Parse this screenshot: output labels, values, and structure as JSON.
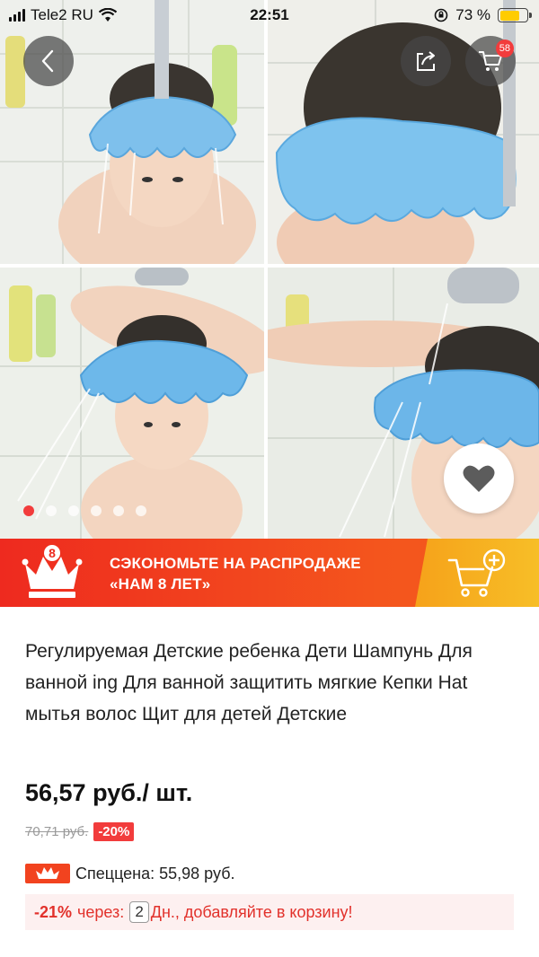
{
  "status_bar": {
    "carrier": "Tele2 RU",
    "time": "22:51",
    "battery_text": "73 %",
    "battery_level": 0.73,
    "battery_color": "#ffcc00"
  },
  "header": {
    "back_icon": "chevron-left-icon",
    "share_icon": "share-icon",
    "cart_icon": "cart-icon",
    "cart_count": "58"
  },
  "gallery": {
    "photo_count": 6,
    "active_index": 0,
    "favorite_icon": "heart-icon"
  },
  "promo": {
    "line1": "СЭКОНОМЬТЕ НА РАСПРОДАЖЕ",
    "line2": "«НАМ 8 ЛЕТ»",
    "logo_icon": "crown-8-icon",
    "cart_icon": "cart-plus-icon",
    "colors": {
      "banner": "#ee2a1f",
      "cart_area": "#f6a21a"
    }
  },
  "product": {
    "title": "Регулируемая Детские ребенка Дети Шампунь Для ванной ing Для ванной защитить мягкие Кепки Hat мытья волос Щит для детей Детские",
    "price": "56,57 руб./ шт.",
    "old_price": "70,71 руб.",
    "discount": "-20%",
    "special_price": "Спеццена: 55,98 руб.",
    "coupon": {
      "percent": "-21%",
      "through": "через:",
      "days": "2",
      "suffix": "Дн., добавляйте в корзину!"
    },
    "accent_color": "#f23c3c"
  }
}
